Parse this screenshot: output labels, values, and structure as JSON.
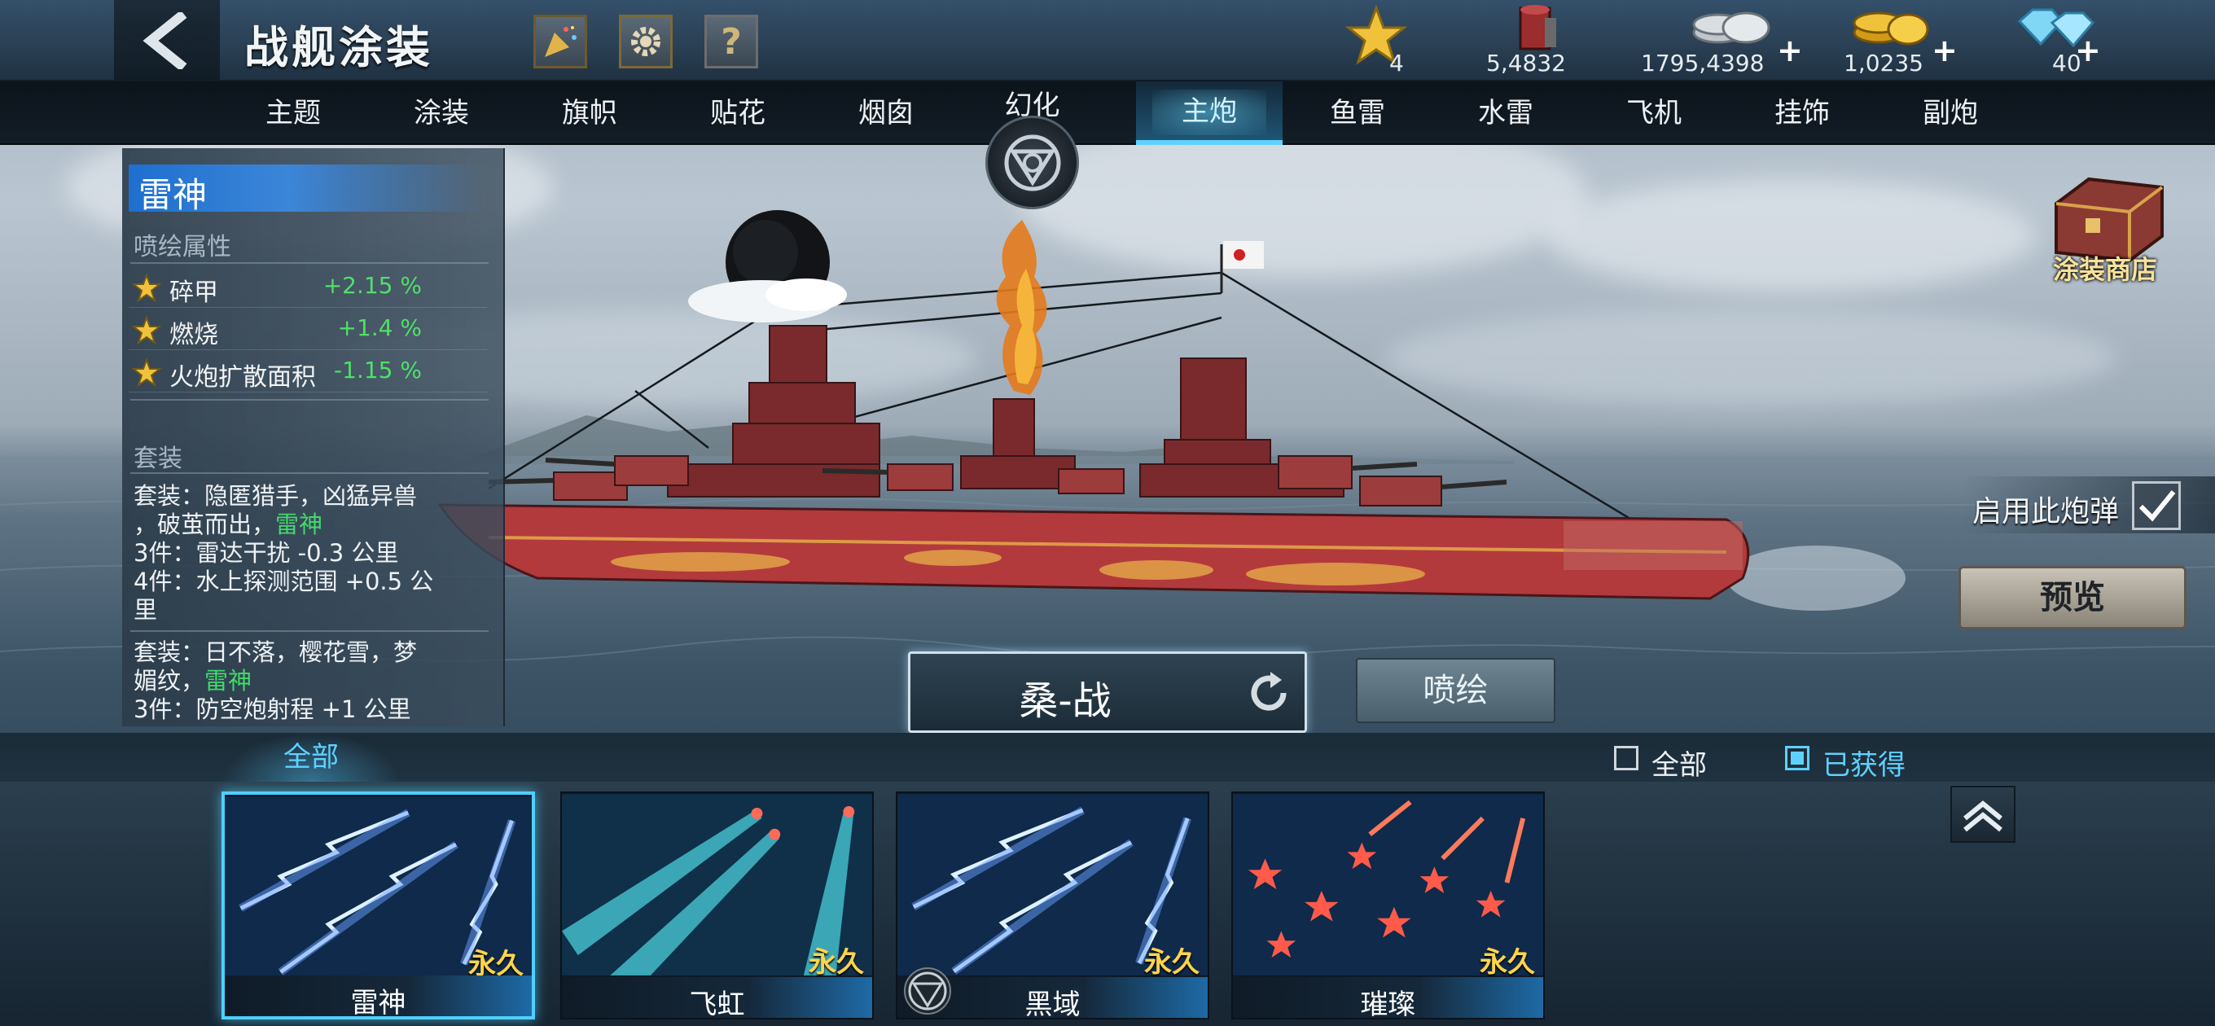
{
  "header": {
    "title": "战舰涂装",
    "resources": [
      {
        "icon": "star-icon",
        "value": "4",
        "has_plus": false
      },
      {
        "icon": "paint-bucket-icon",
        "value": "5,4832",
        "has_plus": false
      },
      {
        "icon": "silver-coins-icon",
        "value": "1795,4398",
        "has_plus": true
      },
      {
        "icon": "gold-coins-icon",
        "value": "1,0235",
        "has_plus": true
      },
      {
        "icon": "diamond-icon",
        "value": "40",
        "has_plus": true
      }
    ],
    "plus_label": "+"
  },
  "tabs": {
    "left": [
      "主题",
      "涂装",
      "旗帜",
      "贴花",
      "烟囱"
    ],
    "center": "幻化",
    "right": [
      "主炮",
      "鱼雷",
      "水雷",
      "飞机",
      "挂饰",
      "副炮"
    ],
    "active": "主炮"
  },
  "info_panel": {
    "skin_name": "雷神",
    "attr_title": "喷绘属性",
    "attributes": [
      {
        "name": "碎甲",
        "value": "+2.15 %"
      },
      {
        "name": "燃烧",
        "value": "+1.4 %"
      },
      {
        "name": "火炮扩散面积",
        "value": "-1.15 %"
      }
    ],
    "set_title": "套装",
    "set1": {
      "line1": "套装：隐匿猎手，凶猛异兽",
      "line2a": "，破茧而出，",
      "line2b": "雷神",
      "line3": "3件：雷达干扰 -0.3 公里",
      "line4": "4件：水上探测范围 +0.5 公",
      "line5": "里"
    },
    "set2": {
      "line1": "套装：日不落，樱花雪，梦",
      "line2a": "媚纹，",
      "line2b": "雷神",
      "line3": "3件：防空炮射程 +1 公里"
    }
  },
  "right_panel": {
    "shop_label": "涂装商店",
    "enable_label": "启用此炮弹",
    "enable_checked": true,
    "preview_label": "预览"
  },
  "ship": {
    "name": "桑-战",
    "spray_label": "喷绘"
  },
  "filter": {
    "tab_all": "全部",
    "check_all": "全部",
    "check_obtained": "已获得",
    "obtained_checked": true
  },
  "cards": [
    {
      "name": "雷神",
      "tag": "永久",
      "style": "lightning",
      "selected": true
    },
    {
      "name": "飞虹",
      "tag": "永久",
      "style": "beam",
      "selected": false
    },
    {
      "name": "黑域",
      "tag": "永久",
      "style": "lightning",
      "selected": false
    },
    {
      "name": "璀璨",
      "tag": "永久",
      "style": "stars",
      "selected": false
    }
  ],
  "colors": {
    "accent_cyan": "#5fd1ff",
    "attr_green": "#4fe06a",
    "permanent_gold": "#ffd44a",
    "hull_red": "#b23a3c"
  }
}
